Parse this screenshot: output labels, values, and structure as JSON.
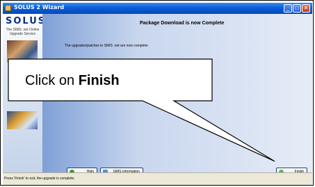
{
  "window": {
    "title": "SOLUS 2 Wizard",
    "minimize_glyph": "_",
    "maximize_glyph": "□",
    "close_glyph": "✕"
  },
  "sidebar": {
    "logo": "SOLUS",
    "tagline": "The SIMS .net Online Upgrade Service"
  },
  "main": {
    "heading": "Package Download is now Complete",
    "message": "The upgrades/patches to SIMS .net are now complete."
  },
  "callout": {
    "prefix": "Click on ",
    "emphasis": "Finish"
  },
  "buttons": {
    "help": "Help",
    "sims_info": "SIMS Information",
    "finish": "Finish"
  },
  "status": {
    "text": "Press 'Finish' to exit, the upgrade is complete."
  },
  "colors": {
    "accent": "#0a5fd6",
    "help_icon": "#2f9a3a",
    "finish_icon": "#6ab04c"
  }
}
